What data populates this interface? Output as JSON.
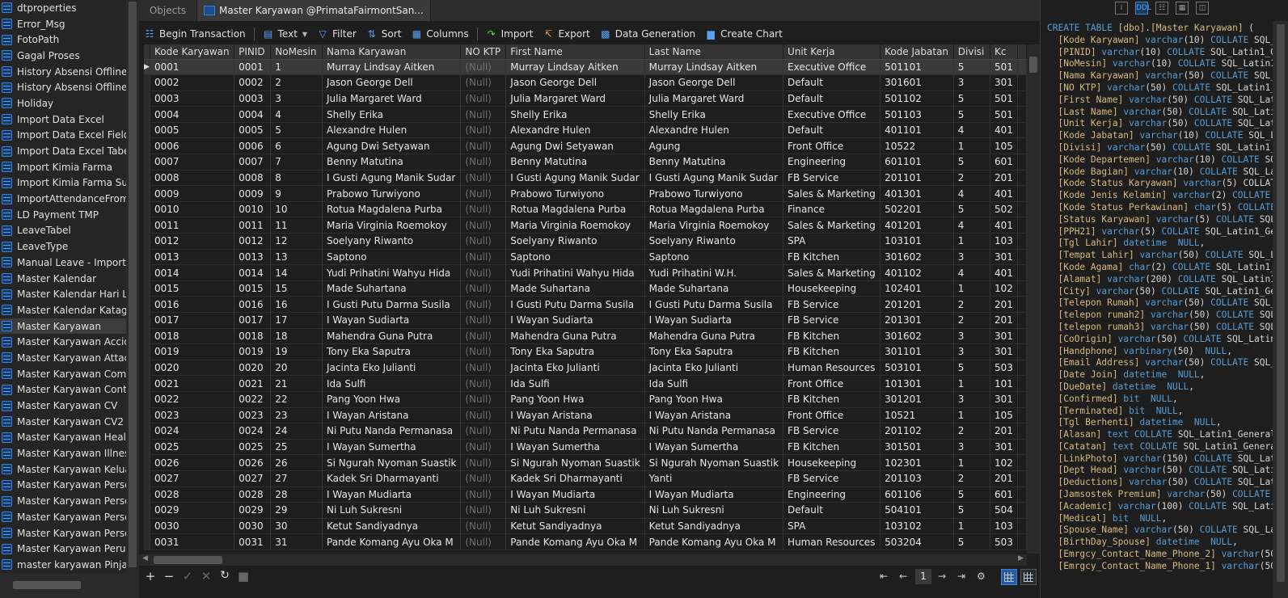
{
  "objects_list": {
    "selected_index": 20,
    "items": [
      {
        "label": "dtproperties"
      },
      {
        "label": "Error_Msg"
      },
      {
        "label": "FotoPath"
      },
      {
        "label": "Gagal Proses"
      },
      {
        "label": "History Absensi Offline Tra"
      },
      {
        "label": "History Absensi Offline Tra"
      },
      {
        "label": "Holiday"
      },
      {
        "label": "Import Data Excel"
      },
      {
        "label": "Import Data Excel Field"
      },
      {
        "label": "Import Data Excel Tabel"
      },
      {
        "label": "Import Kimia Farma"
      },
      {
        "label": "Import Kimia Farma Subfo"
      },
      {
        "label": "ImportAttendanceFromXL"
      },
      {
        "label": "LD Payment TMP"
      },
      {
        "label": "LeaveTabel"
      },
      {
        "label": "LeaveType"
      },
      {
        "label": "Manual Leave - Import Fro"
      },
      {
        "label": "Master Kalendar"
      },
      {
        "label": "Master Kalendar Hari Libu"
      },
      {
        "label": "Master Kalendar Katagori"
      },
      {
        "label": "Master Karyawan"
      },
      {
        "label": "Master Karyawan Acciden"
      },
      {
        "label": "Master Karyawan Attachm"
      },
      {
        "label": "Master Karyawan Compet"
      },
      {
        "label": "Master Karyawan Contrac"
      },
      {
        "label": "Master Karyawan CV"
      },
      {
        "label": "Master Karyawan CV2"
      },
      {
        "label": "Master Karyawan Health"
      },
      {
        "label": "Master Karyawan Illness"
      },
      {
        "label": "Master Karyawan Keluarga"
      },
      {
        "label": "Master Karyawan Personn"
      },
      {
        "label": "Master Karyawan Personn"
      },
      {
        "label": "Master Karyawan Personn"
      },
      {
        "label": "Master Karyawan Personn"
      },
      {
        "label": "Master Karyawan Perubah"
      },
      {
        "label": "master karyawan Pinjama"
      }
    ]
  },
  "tabs": {
    "objects": "Objects",
    "active": "Master Karyawan @PrimataFairmontSan..."
  },
  "toolbar": {
    "begin_transaction": "Begin Transaction",
    "text": "Text",
    "filter": "Filter",
    "sort": "Sort",
    "columns": "Columns",
    "import": "Import",
    "export": "Export",
    "data_generation": "Data Generation",
    "create_chart": "Create Chart"
  },
  "grid": {
    "columns": [
      "Kode Karyawan",
      "PINID",
      "NoMesin",
      "Nama Karyawan",
      "NO KTP",
      "First Name",
      "Last Name",
      "Unit Kerja",
      "Kode Jabatan",
      "Divisi",
      "Kc"
    ],
    "null_text": "(Null)",
    "selected_row": 0,
    "rows": [
      [
        "0001",
        "0001",
        "1",
        "Murray Lindsay Aitken",
        "(Null)",
        "Murray Lindsay Aitken",
        "Murray Lindsay Aitken",
        "Executive Office",
        "501101",
        "5",
        "501"
      ],
      [
        "0002",
        "0002",
        "2",
        "Jason George Dell",
        "(Null)",
        "Jason George Dell",
        "Jason George Dell",
        "Default",
        "301601",
        "3",
        "301"
      ],
      [
        "0003",
        "0003",
        "3",
        "Julia Margaret Ward",
        "(Null)",
        "Julia Margaret Ward",
        "Julia Margaret Ward",
        "Default",
        "501102",
        "5",
        "501"
      ],
      [
        "0004",
        "0004",
        "4",
        "Shelly Erika",
        "(Null)",
        "Shelly Erika",
        "Shelly Erika",
        "Executive Office",
        "501103",
        "5",
        "501"
      ],
      [
        "0005",
        "0005",
        "5",
        "Alexandre Hulen",
        "(Null)",
        "Alexandre Hulen",
        "Alexandre Hulen",
        "Default",
        "401101",
        "4",
        "401"
      ],
      [
        "0006",
        "0006",
        "6",
        "Agung Dwi Setyawan",
        "(Null)",
        "Agung Dwi Setyawan",
        "Agung",
        "Front Office",
        "10522",
        "1",
        "105"
      ],
      [
        "0007",
        "0007",
        "7",
        "Benny Matutina",
        "(Null)",
        "Benny Matutina",
        "Benny Matutina",
        "Engineering",
        "601101",
        "5",
        "601"
      ],
      [
        "0008",
        "0008",
        "8",
        "I Gusti Agung Manik Sudar",
        "(Null)",
        "I Gusti Agung Manik Sudar",
        "I Gusti Agung Manik Sudar",
        "FB Service",
        "201101",
        "2",
        "201"
      ],
      [
        "0009",
        "0009",
        "9",
        "Prabowo Turwiyono",
        "(Null)",
        "Prabowo Turwiyono",
        "Prabowo Turwiyono",
        "Sales & Marketing",
        "401301",
        "4",
        "401"
      ],
      [
        "0010",
        "0010",
        "10",
        "Rotua Magdalena Purba",
        "(Null)",
        "Rotua Magdalena Purba",
        "Rotua Magdalena Purba",
        "Finance",
        "502201",
        "5",
        "502"
      ],
      [
        "0011",
        "0011",
        "11",
        "Maria Virginia Roemokoy",
        "(Null)",
        "Maria Virginia Roemokoy",
        "Maria Virginia Roemokoy",
        "Sales & Marketing",
        "401201",
        "4",
        "401"
      ],
      [
        "0012",
        "0012",
        "12",
        "Soelyany Riwanto",
        "(Null)",
        "Soelyany Riwanto",
        "Soelyany Riwanto",
        "SPA",
        "103101",
        "1",
        "103"
      ],
      [
        "0013",
        "0013",
        "13",
        "Saptono",
        "(Null)",
        "Saptono",
        "Saptono",
        "FB Kitchen",
        "301602",
        "3",
        "301"
      ],
      [
        "0014",
        "0014",
        "14",
        "Yudi Prihatini Wahyu Hida",
        "(Null)",
        "Yudi Prihatini Wahyu Hida",
        "Yudi Prihatini W.H.",
        "Sales & Marketing",
        "401102",
        "4",
        "401"
      ],
      [
        "0015",
        "0015",
        "15",
        "Made Suhartana",
        "(Null)",
        "Made Suhartana",
        "Made Suhartana",
        "Housekeeping",
        "102401",
        "1",
        "102"
      ],
      [
        "0016",
        "0016",
        "16",
        "I Gusti Putu Darma Susila",
        "(Null)",
        "I Gusti Putu Darma Susila",
        "I Gusti Putu Darma Susila",
        "FB Service",
        "201201",
        "2",
        "201"
      ],
      [
        "0017",
        "0017",
        "17",
        "I Wayan Sudiarta",
        "(Null)",
        "I Wayan Sudiarta",
        "I Wayan Sudiarta",
        "FB Service",
        "201301",
        "2",
        "201"
      ],
      [
        "0018",
        "0018",
        "18",
        "Mahendra Guna Putra",
        "(Null)",
        "Mahendra Guna Putra",
        "Mahendra Guna Putra",
        "FB Kitchen",
        "301602",
        "3",
        "301"
      ],
      [
        "0019",
        "0019",
        "19",
        "Tony Eka Saputra",
        "(Null)",
        "Tony Eka Saputra",
        "Tony Eka Saputra",
        "FB Kitchen",
        "301101",
        "3",
        "301"
      ],
      [
        "0020",
        "0020",
        "20",
        "Jacinta Eko Julianti",
        "(Null)",
        "Jacinta Eko Julianti",
        "Jacinta Eko Julianti",
        "Human Resources",
        "503101",
        "5",
        "503"
      ],
      [
        "0021",
        "0021",
        "21",
        "Ida Sulfi",
        "(Null)",
        "Ida Sulfi",
        "Ida Sulfi",
        "Front Office",
        "101301",
        "1",
        "101"
      ],
      [
        "0022",
        "0022",
        "22",
        "Pang Yoon Hwa",
        "(Null)",
        "Pang Yoon Hwa",
        "Pang Yoon Hwa",
        "FB Kitchen",
        "301201",
        "3",
        "301"
      ],
      [
        "0023",
        "0023",
        "23",
        "I Wayan Aristana",
        "(Null)",
        "I Wayan Aristana",
        "I Wayan Aristana",
        "Front Office",
        "10521",
        "1",
        "105"
      ],
      [
        "0024",
        "0024",
        "24",
        "Ni Putu Nanda Permanasa",
        "(Null)",
        "Ni Putu Nanda Permanasa",
        "Ni Putu Nanda Permanasa",
        "FB Service",
        "201102",
        "2",
        "201"
      ],
      [
        "0025",
        "0025",
        "25",
        "I Wayan Sumertha",
        "(Null)",
        "I Wayan Sumertha",
        "I Wayan Sumertha",
        "FB Kitchen",
        "301501",
        "3",
        "301"
      ],
      [
        "0026",
        "0026",
        "26",
        "Si Ngurah Nyoman Suastik",
        "(Null)",
        "Si Ngurah Nyoman Suastik",
        "Si Ngurah Nyoman Suastik",
        "Housekeeping",
        "102301",
        "1",
        "102"
      ],
      [
        "0027",
        "0027",
        "27",
        "Kadek Sri Dharmayanti",
        "(Null)",
        "Kadek Sri Dharmayanti",
        "Yanti",
        "FB Service",
        "201103",
        "2",
        "201"
      ],
      [
        "0028",
        "0028",
        "28",
        "I Wayan Mudiarta",
        "(Null)",
        "I Wayan Mudiarta",
        "I Wayan Mudiarta",
        "Engineering",
        "601106",
        "5",
        "601"
      ],
      [
        "0029",
        "0029",
        "29",
        "Ni Luh Sukresni",
        "(Null)",
        "Ni Luh Sukresni",
        "Ni Luh Sukresni",
        "Default",
        "504101",
        "5",
        "504"
      ],
      [
        "0030",
        "0030",
        "30",
        "Ketut Sandiyadnya",
        "(Null)",
        "Ketut Sandiyadnya",
        "Ketut Sandiyadnya",
        "SPA",
        "103102",
        "1",
        "103"
      ],
      [
        "0031",
        "0031",
        "31",
        "Pande Komang Ayu Oka M",
        "(Null)",
        "Pande Komang Ayu Oka M",
        "Pande Komang Ayu Oka M",
        "Human Resources",
        "503204",
        "5",
        "503"
      ]
    ]
  },
  "pager": {
    "page": "1"
  },
  "ddl": {
    "lines": [
      "CREATE TABLE [dbo].[Master Karyawan] (",
      "  [Kode Karyawan] varchar(10) COLLATE SQL_",
      "  [PINID] varchar(10) COLLATE SQL_Latin1_G",
      "  [NoMesin] varchar(10) COLLATE SQL_Latin1",
      "  [Nama Karyawan] varchar(50) COLLATE SQL_",
      "  [NO KTP] varchar(50) COLLATE SQL_Latin1_",
      "  [First Name] varchar(50) COLLATE SQL_Lat",
      "  [Last Name] varchar(50) COLLATE SQL_Lati",
      "  [Unit Kerja] varchar(50) COLLATE SQL_Lat",
      "  [Kode Jabatan] varchar(10) COLLATE SQL_L",
      "  [Divisi] varchar(50) COLLATE SQL_Latin1_",
      "  [Kode Departemen] varchar(10) COLLATE SQ",
      "  [Kode Bagian] varchar(10) COLLATE SQL_La",
      "  [Kode Status Karyawan] varchar(5) COLLAT",
      "  [Kode Jenis Kelamin] varchar(2) COLLATE",
      "  [Kode Status Perkawinan] char(5) COLLATE",
      "  [Status Karyawan] varchar(5) COLLATE SQL",
      "  [PPH21] varchar(5) COLLATE SQL_Latin1_Ge",
      "  [Tgl Lahir] datetime  NULL,",
      "  [Tempat Lahir] varchar(50) COLLATE SQL_L",
      "  [Kode Agama] char(2) COLLATE SQL_Latin1_",
      "  [Alamat] varchar(200) COLLATE SQL_Latin1",
      "  [City] varchar(50) COLLATE SQL_Latin1_Ge",
      "  [Telepon Rumah] varchar(50) COLLATE SQL_",
      "  [telepon rumah2] varchar(50) COLLATE SQL",
      "  [telepon rumah3] varchar(50) COLLATE SQL",
      "  [CoOrigin] varchar(50) COLLATE SQL_Latin",
      "  [Handphone] varbinary(50)  NULL,",
      "  [Email Address] varchar(50) COLLATE SQL_",
      "  [Date Join] datetime  NULL,",
      "  [DueDate] datetime  NULL,",
      "  [Confirmed] bit  NULL,",
      "  [Terminated] bit  NULL,",
      "  [Tgl Berhenti] datetime  NULL,",
      "  [Alasan] text COLLATE SQL_Latin1_General",
      "  [Catatan] text COLLATE SQL_Latin1_Genera",
      "  [LinkPhoto] varchar(150) COLLATE SQL_Lat",
      "  [Dept Head] varchar(50) COLLATE SQL_Lati",
      "  [Deductions] varchar(50) COLLATE SQL_Lat",
      "  [Jamsostek Premium] varchar(50) COLLATE",
      "  [Academic] varchar(100) COLLATE SQL_Lati",
      "  [Medical] bit  NULL,",
      "  [Spouse_Name] varchar(50) COLLATE SQL_La",
      "  [BirthDay_Spouse] datetime  NULL,",
      "  [Emrgcy_Contact_Name_Phone_2] varchar(50",
      "  [Emrgcy_Contact_Name_Phone_1] varchar(50"
    ]
  },
  "colors": {
    "accent": "#3a82d8",
    "keyword": "#569cd6",
    "null_text": "#6f6f6f"
  }
}
